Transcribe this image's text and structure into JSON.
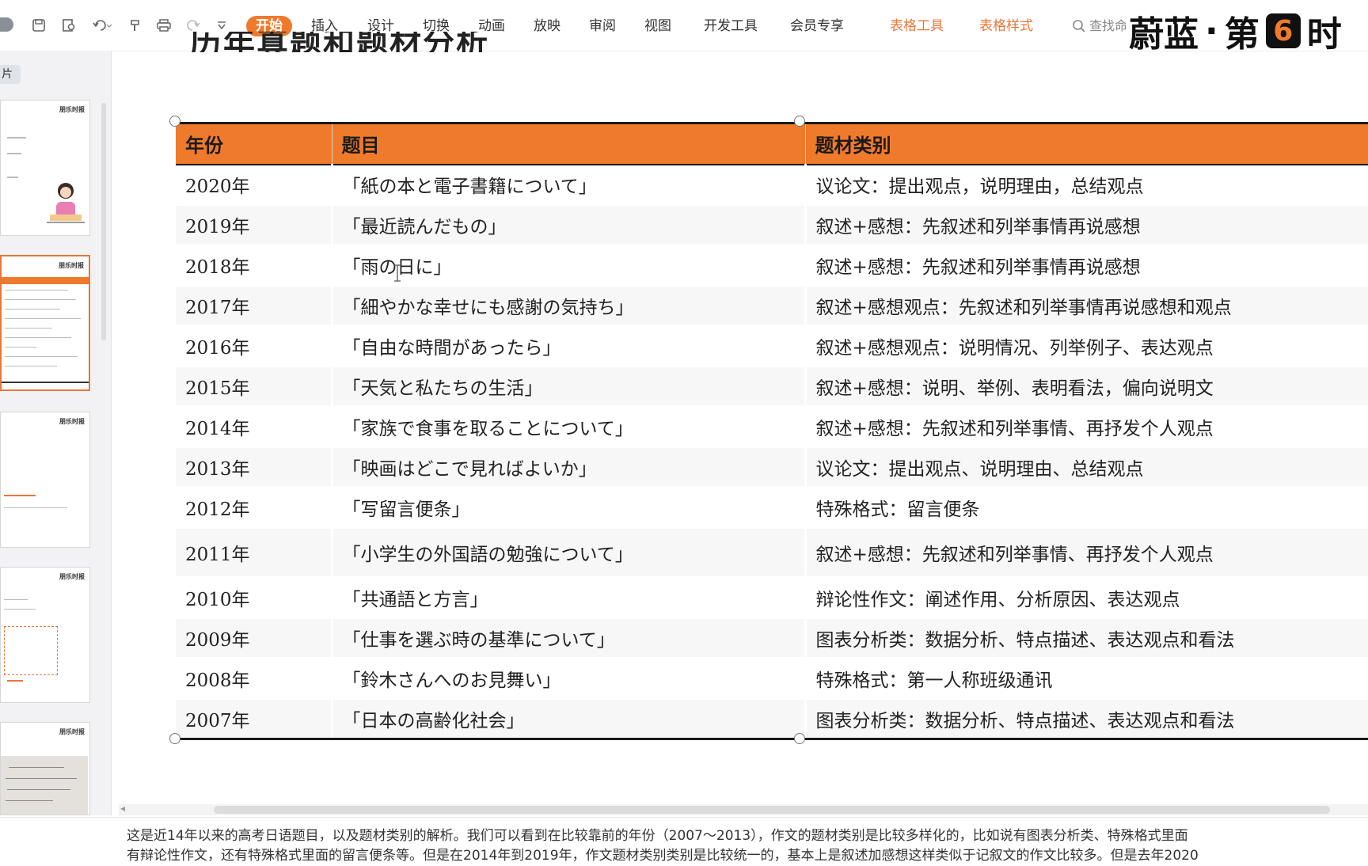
{
  "toolbar": {
    "tabs": [
      "开始",
      "插入",
      "设计",
      "切换",
      "动画",
      "放映",
      "审阅",
      "视图",
      "开发工具",
      "会员专享"
    ],
    "context_tabs": [
      "表格工具",
      "表格样式"
    ],
    "search_placeholder": "查找命",
    "quick_icons": [
      "save-icon",
      "print-preview-icon",
      "undo-icon",
      "format-painter-icon",
      "print-icon",
      "redo-icon",
      "more-icon"
    ]
  },
  "brand": {
    "text_left": "蔚蓝",
    "dot": "·",
    "text_right_a": "第",
    "six": "6",
    "text_right_b": "时"
  },
  "slide_heading": "历年真题和题材分析",
  "left_panel": {
    "label": "片",
    "thumb_brand": "朋乐时报"
  },
  "table": {
    "headers": [
      "年份",
      "题目",
      "题材类别"
    ],
    "rows": [
      [
        "2020年",
        "「紙の本と電子書籍について」",
        "议论文：提出观点，说明理由，总结观点"
      ],
      [
        "2019年",
        "「最近読んだもの」",
        "叙述+感想：先叙述和列举事情再说感想"
      ],
      [
        "2018年",
        "「雨の日に」",
        "叙述+感想：先叙述和列举事情再说感想"
      ],
      [
        "2017年",
        "「細やかな幸せにも感謝の気持ち」",
        "叙述+感想观点：先叙述和列举事情再说感想和观点"
      ],
      [
        "2016年",
        "「自由な時間があったら」",
        "叙述+感想观点：说明情况、列举例子、表达观点"
      ],
      [
        "2015年",
        "「天気と私たちの生活」",
        "叙述+感想：说明、举例、表明看法，偏向说明文"
      ],
      [
        "2014年",
        "「家族で食事を取ることについて」",
        "叙述+感想：先叙述和列举事情、再抒发个人观点"
      ],
      [
        "2013年",
        "「映画はどこで見ればよいか」",
        "议论文：提出观点、说明理由、总结观点"
      ],
      [
        "2012年",
        "「写留言便条」",
        "特殊格式：留言便条"
      ],
      [
        "2011年",
        "「小学生の外国語の勉強について」",
        "叙述+感想：先叙述和列举事情、再抒发个人观点"
      ],
      [
        "2010年",
        "「共通語と方言」",
        "辩论性作文：阐述作用、分析原因、表达观点"
      ],
      [
        "2009年",
        "「仕事を選ぶ時の基準について」",
        "图表分析类：数据分析、特点描述、表达观点和看法"
      ],
      [
        "2008年",
        "「鈴木さんへのお見舞い」",
        "特殊格式：第一人称班级通讯"
      ],
      [
        "2007年",
        "「日本の高齢化社会」",
        "图表分析类：数据分析、特点描述、表达观点和看法"
      ]
    ]
  },
  "notes": {
    "line1": "这是近14年以来的高考日语题目，以及题材类别的解析。我们可以看到在比较靠前的年份（2007～2013），作文的题材类别是比较多样化的，比如说有图表分析类、特殊格式里面",
    "line2": "有辩论性作文，还有特殊格式里面的留言便条等。但是在2014年到2019年，作文题材类别类别是比较统一的，基本上是叙述加感想这样类似于记叙文的作文比较多。但是去年2020"
  },
  "colors": {
    "accent": "#f07a2c",
    "context_tab": "#e8773a"
  }
}
